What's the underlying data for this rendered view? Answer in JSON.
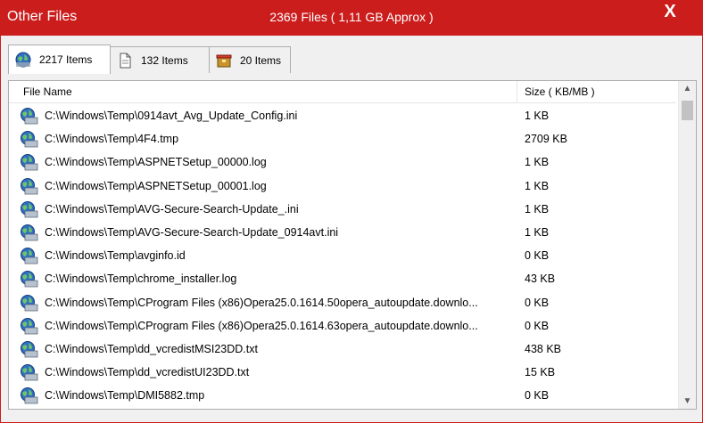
{
  "window": {
    "title": "Other Files",
    "summary": "2369 Files ( 1,11 GB Approx )",
    "close_label": "X"
  },
  "tabs": [
    {
      "label": "2217 Items",
      "icon": "globe-folder-icon",
      "active": true
    },
    {
      "label": "132 Items",
      "icon": "file-icon",
      "active": false
    },
    {
      "label": "20 Items",
      "icon": "box-icon",
      "active": false
    }
  ],
  "list": {
    "columns": {
      "name": "File Name",
      "size": "Size ( KB/MB )"
    },
    "rows": [
      {
        "path": "C:\\Windows\\Temp\\0914avt_Avg_Update_Config.ini",
        "size": "1 KB"
      },
      {
        "path": "C:\\Windows\\Temp\\4F4.tmp",
        "size": "2709 KB"
      },
      {
        "path": "C:\\Windows\\Temp\\ASPNETSetup_00000.log",
        "size": "1 KB"
      },
      {
        "path": "C:\\Windows\\Temp\\ASPNETSetup_00001.log",
        "size": "1 KB"
      },
      {
        "path": "C:\\Windows\\Temp\\AVG-Secure-Search-Update_.ini",
        "size": "1 KB"
      },
      {
        "path": "C:\\Windows\\Temp\\AVG-Secure-Search-Update_0914avt.ini",
        "size": "1 KB"
      },
      {
        "path": "C:\\Windows\\Temp\\avginfo.id",
        "size": "0 KB"
      },
      {
        "path": "C:\\Windows\\Temp\\chrome_installer.log",
        "size": "43 KB"
      },
      {
        "path": "C:\\Windows\\Temp\\CProgram Files (x86)Opera25.0.1614.50opera_autoupdate.downlo...",
        "size": "0 KB"
      },
      {
        "path": "C:\\Windows\\Temp\\CProgram Files (x86)Opera25.0.1614.63opera_autoupdate.downlo...",
        "size": "0 KB"
      },
      {
        "path": "C:\\Windows\\Temp\\dd_vcredistMSI23DD.txt",
        "size": "438 KB"
      },
      {
        "path": "C:\\Windows\\Temp\\dd_vcredistUI23DD.txt",
        "size": "15 KB"
      },
      {
        "path": "C:\\Windows\\Temp\\DMI5882.tmp",
        "size": "0 KB"
      }
    ]
  },
  "colors": {
    "titlebar": "#cc1d1d",
    "panel": "#f0f0f0",
    "list_bg": "#ffffff"
  }
}
